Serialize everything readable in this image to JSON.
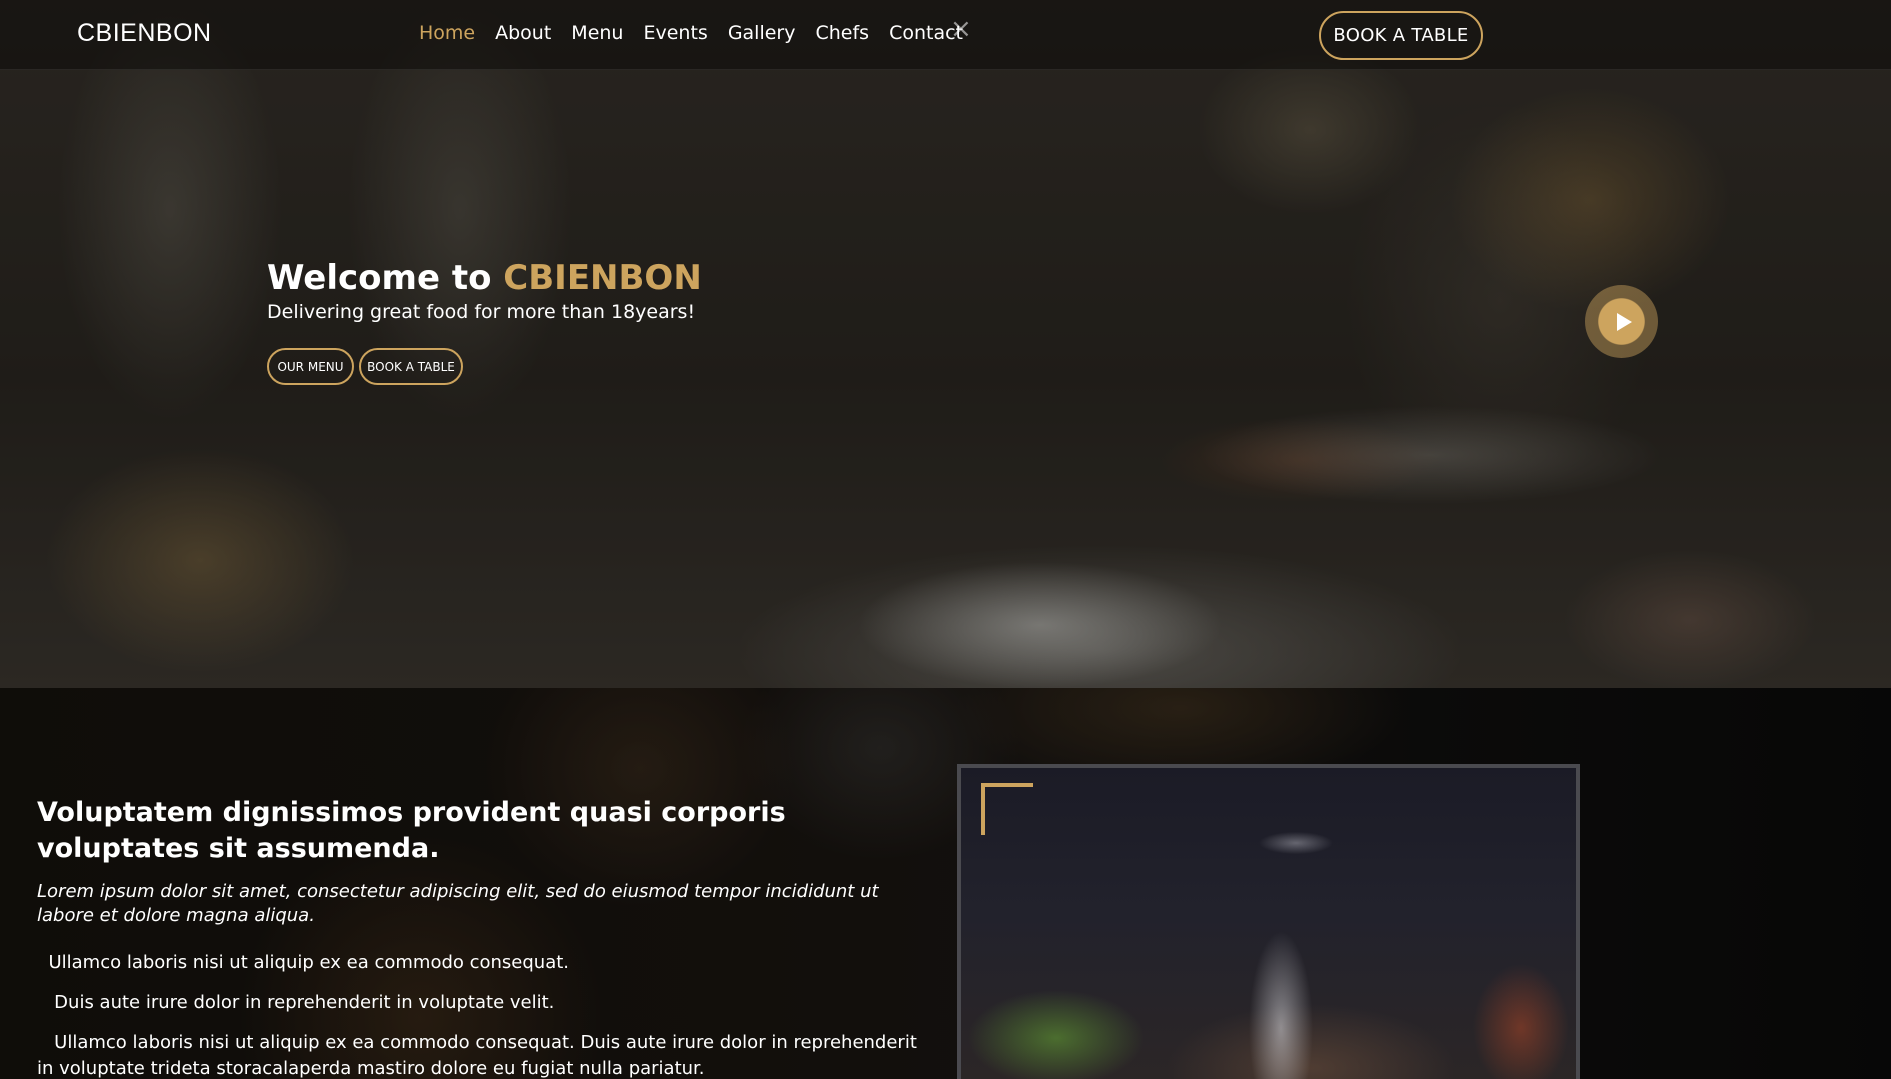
{
  "header": {
    "logo": "CBIENBON",
    "nav": [
      "Home",
      "About",
      "Menu",
      "Events",
      "Gallery",
      "Chefs",
      "Contact"
    ],
    "active_nav": "Home",
    "close_icon": "×",
    "book_label": "BOOK A TABLE"
  },
  "hero": {
    "title_prefix": "Welcome to ",
    "title_brand": "CBIENBON",
    "subtitle": "Delivering great food for more than 18years!",
    "menu_button": "OUR MENU",
    "book_button": "BOOK A TABLE",
    "play_icon": "play-icon"
  },
  "about": {
    "heading": "Voluptatem dignissimos provident quasi corporis voluptates sit assumenda.",
    "lead": "Lorem ipsum dolor sit amet, consectetur adipiscing elit, sed do eiusmod tempor incididunt ut labore et dolore magna aliqua.",
    "items": [
      "  Ullamco laboris nisi ut aliquip ex ea commodo consequat.",
      "   Duis aute irure dolor in reprehenderit in voluptate velit.",
      "   Ullamco laboris nisi ut aliquip ex ea commodo consequat. Duis aute irure dolor in reprehenderit in voluptate trideta storacalaperda mastiro dolore eu fugiat nulla pariatur."
    ]
  },
  "colors": {
    "accent": "#cda45e",
    "background": "#0c0b09"
  }
}
